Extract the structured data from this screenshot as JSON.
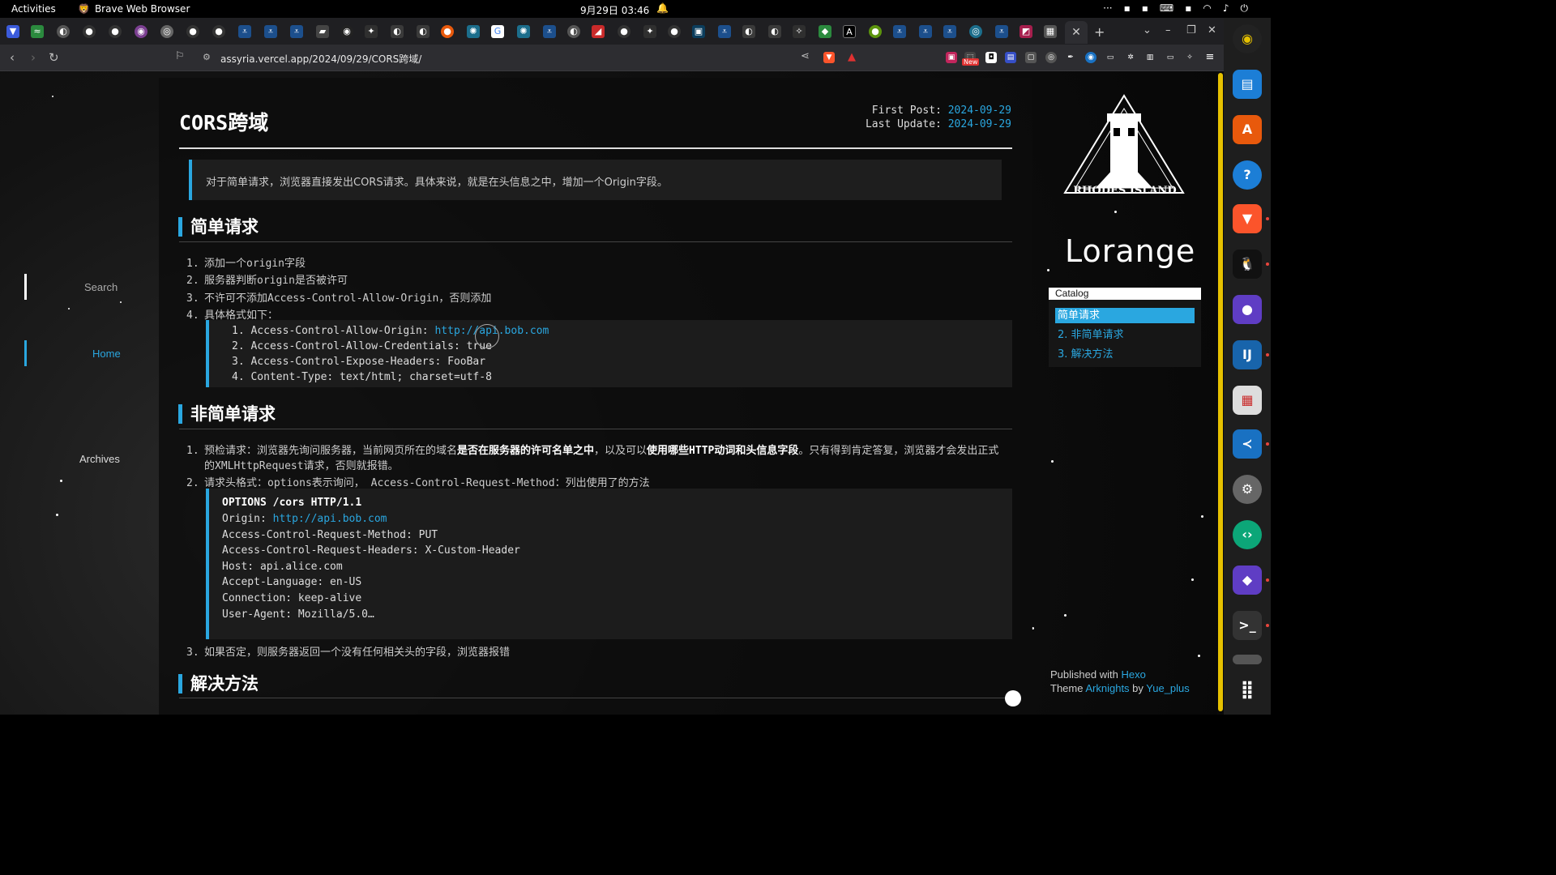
{
  "topbar": {
    "activities": "Activities",
    "app_name": "Brave Web Browser",
    "clock": "9月29日  03:46"
  },
  "browser": {
    "url": "assyria.vercel.app/2024/09/29/CORS跨域/",
    "ext_new_badge": "New"
  },
  "leftnav": {
    "search": "Search",
    "home": "Home",
    "archives": "Archives"
  },
  "post": {
    "title": "CORS跨域",
    "first_post_label": "First Post: ",
    "first_post_date": "2024-09-29",
    "last_update_label": "Last Update: ",
    "last_update_date": "2024-09-29",
    "quote": "对于简单请求，浏览器直接发出CORS请求。具体来说，就是在头信息之中，增加一个Origin字段。",
    "section1": {
      "heading": "简单请求",
      "items": [
        "添加一个origin字段",
        "服务器判断origin是否被许可",
        "不许可不添加Access-Control-Allow-Origin，否则添加",
        "具体格式如下："
      ],
      "code": [
        {
          "n": "1.",
          "text": "Access-Control-Allow-Origin: ",
          "link": "http://api.bob.com"
        },
        {
          "n": "2.",
          "text": "Access-Control-Allow-Credentials: true",
          "link": ""
        },
        {
          "n": "3.",
          "text": "Access-Control-Expose-Headers: FooBar",
          "link": ""
        },
        {
          "n": "4.",
          "text": "Content-Type: text/html; charset=utf-8",
          "link": ""
        }
      ]
    },
    "section2": {
      "heading": "非简单请求",
      "item1_a": "预检请求：浏览器先询问服务器，当前网页所在的域名",
      "item1_b": "是否在服务器的许可名单之中",
      "item1_c": "，以及可以",
      "item1_d": "使用哪些HTTP动词和头信息字段",
      "item1_e": "。只有得到肯定答复，浏览器才会发出正式",
      "item1_line2": "的XMLHttpRequest请求，否则就报错。",
      "item2": "请求头格式：options表示询问，  Access-Control-Request-Method：列出使用了的方法",
      "code": [
        {
          "text": "OPTIONS /cors HTTP/1.1",
          "link": ""
        },
        {
          "text": "Origin: ",
          "link": "http://api.bob.com"
        },
        {
          "text": "Access-Control-Request-Method: PUT",
          "link": ""
        },
        {
          "text": "Access-Control-Request-Headers: X-Custom-Header",
          "link": ""
        },
        {
          "text": "Host: api.alice.com",
          "link": ""
        },
        {
          "text": "Accept-Language: en-US",
          "link": ""
        },
        {
          "text": "Connection: keep-alive",
          "link": ""
        },
        {
          "text": "User-Agent: Mozilla/5.0…",
          "link": ""
        }
      ],
      "item3": "如果否定，则服务器返回一个没有任何相关头的字段，浏览器报错"
    },
    "section3": {
      "heading": "解决方法"
    }
  },
  "sidebar": {
    "logo_text": "RHODES ISLAND",
    "brand": "Lorange",
    "catalog_title": "Catalog",
    "catalog_items": [
      "简单请求",
      "2. 非简单请求",
      "3. 解决方法"
    ],
    "footer_published": "Published with ",
    "footer_hexo": "Hexo",
    "footer_theme": "Theme ",
    "footer_theme_name": "Arknights",
    "footer_by": " by ",
    "footer_author": "Yue_plus"
  },
  "colors": {
    "accent": "#2aa7e0",
    "scroll_thumb": "#e6c100"
  }
}
